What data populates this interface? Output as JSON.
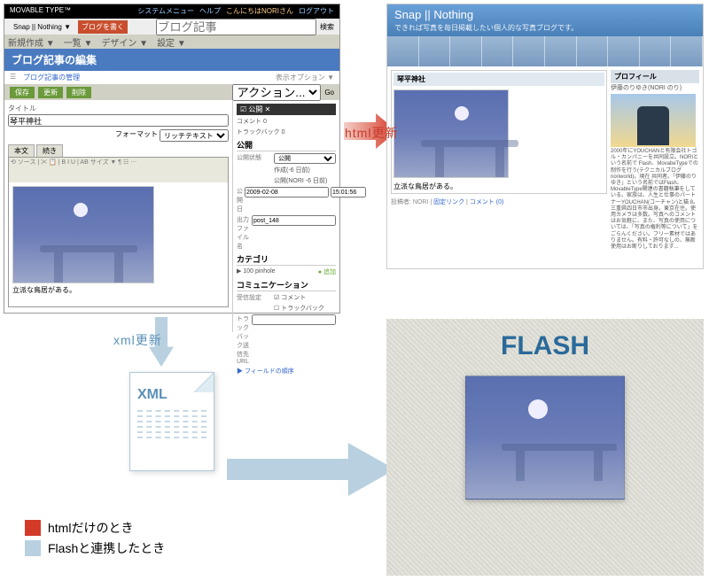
{
  "mt": {
    "brand": "MOVABLE TYPE™",
    "topmenu": {
      "sys": "システムメニュー",
      "help": "ヘルプ",
      "greet": "こんにちはNORIさん",
      "logout": "ログアウト"
    },
    "tabs": {
      "site": "Snap || Nothing ▼",
      "write": "ブログを書く"
    },
    "search": {
      "btn": "検索",
      "ph": "ブログ記事"
    },
    "nav": {
      "create": "新規作成 ▼",
      "list": "一覧 ▼",
      "design": "デザイン ▼",
      "settings": "設定 ▼"
    },
    "crumb": {
      "dash": "☰",
      "path": "ブログ記事の管理",
      "opt": "表示オプション ▼"
    },
    "title": "ブログ記事の編集",
    "toolbar": {
      "save": "保存",
      "upd": "更新",
      "del": "削除",
      "action": "アクション...",
      "go": "Go"
    },
    "field": {
      "title_lbl": "タイトル",
      "title_val": "琴平神社"
    },
    "format": {
      "lbl": "フォーマット",
      "val": "リッチテキスト"
    },
    "bodytabs": {
      "t1": "本文",
      "t2": "続き"
    },
    "wysi": "⟲ ソース | ✂ 📋 | B I U | AB サイズ ▼ ¶ ☷ ⋯",
    "caption": "立派な鳥居がある。",
    "side": {
      "status_hd": "☑ 公開 ✕",
      "comments": "コメント 0",
      "trackbacks": "トラックバック 0",
      "pub": "公開",
      "state_lbl": "公開状態",
      "state_v": "公開",
      "state_d1": "作成(-6 日前)",
      "state_d2": "公開(NORI -6 日前)",
      "date_lbl": "公開日",
      "date_v": "2009-02-08",
      "time_v": "15:01:56",
      "out_lbl": "出力ファイル名",
      "out_v": "post_148",
      "cat": "カテゴリ",
      "cat_v": "▶ 100 pinhole",
      "cat_add": "● 追加",
      "comm": "コミュニケーション",
      "comm_s": "受信設定",
      "comm_c": "☑ コメント",
      "comm_t": "☐ トラックバック",
      "tb": "トラックバック送信先URL",
      "link": "▶ フィールドの順序"
    }
  },
  "blog": {
    "title": "Snap || Nothing",
    "sub": "できれば写真を毎日掲載したい個人的な写真ブログです。",
    "entry": "琴平神社",
    "caption": "立派な鳥居がある。",
    "meta": {
      "who": "投稿者: NORI",
      "perma": "固定リンク",
      "c": "コメント (0)"
    },
    "prof": "プロフィール",
    "name": "伊藤のりゆき(NORI のり)",
    "txt": "2000年にYOUCHANと有限会社トゴル・カンパニーを共同設立。NORIという名前で Flash、MovabeTypeでの制作を行う(テクニカルブログnoriworld)。現在 共同者。「伊藤のりゆき」という名前ではFlash、MovableType関連の書籍執筆をしている。家族は、人生と仕事のパートナーYOUCHAN(コーチャン)と猫 8。三重県四日市市出身。東京在住。使用カメラは多数。写真へのコメントはお気軽に、また、写真の使用については、「写真の権利等について」をごらんください。フリー素材ではありません。有料・許可なしの、無断使用はお断りしております..."
  },
  "labels": {
    "html_update": "html更新",
    "xml_update": "xml更新",
    "xml": "XML",
    "flash": "FLASH",
    "legend_html": "htmlだけのとき",
    "legend_flash": "Flashと連携したとき"
  }
}
